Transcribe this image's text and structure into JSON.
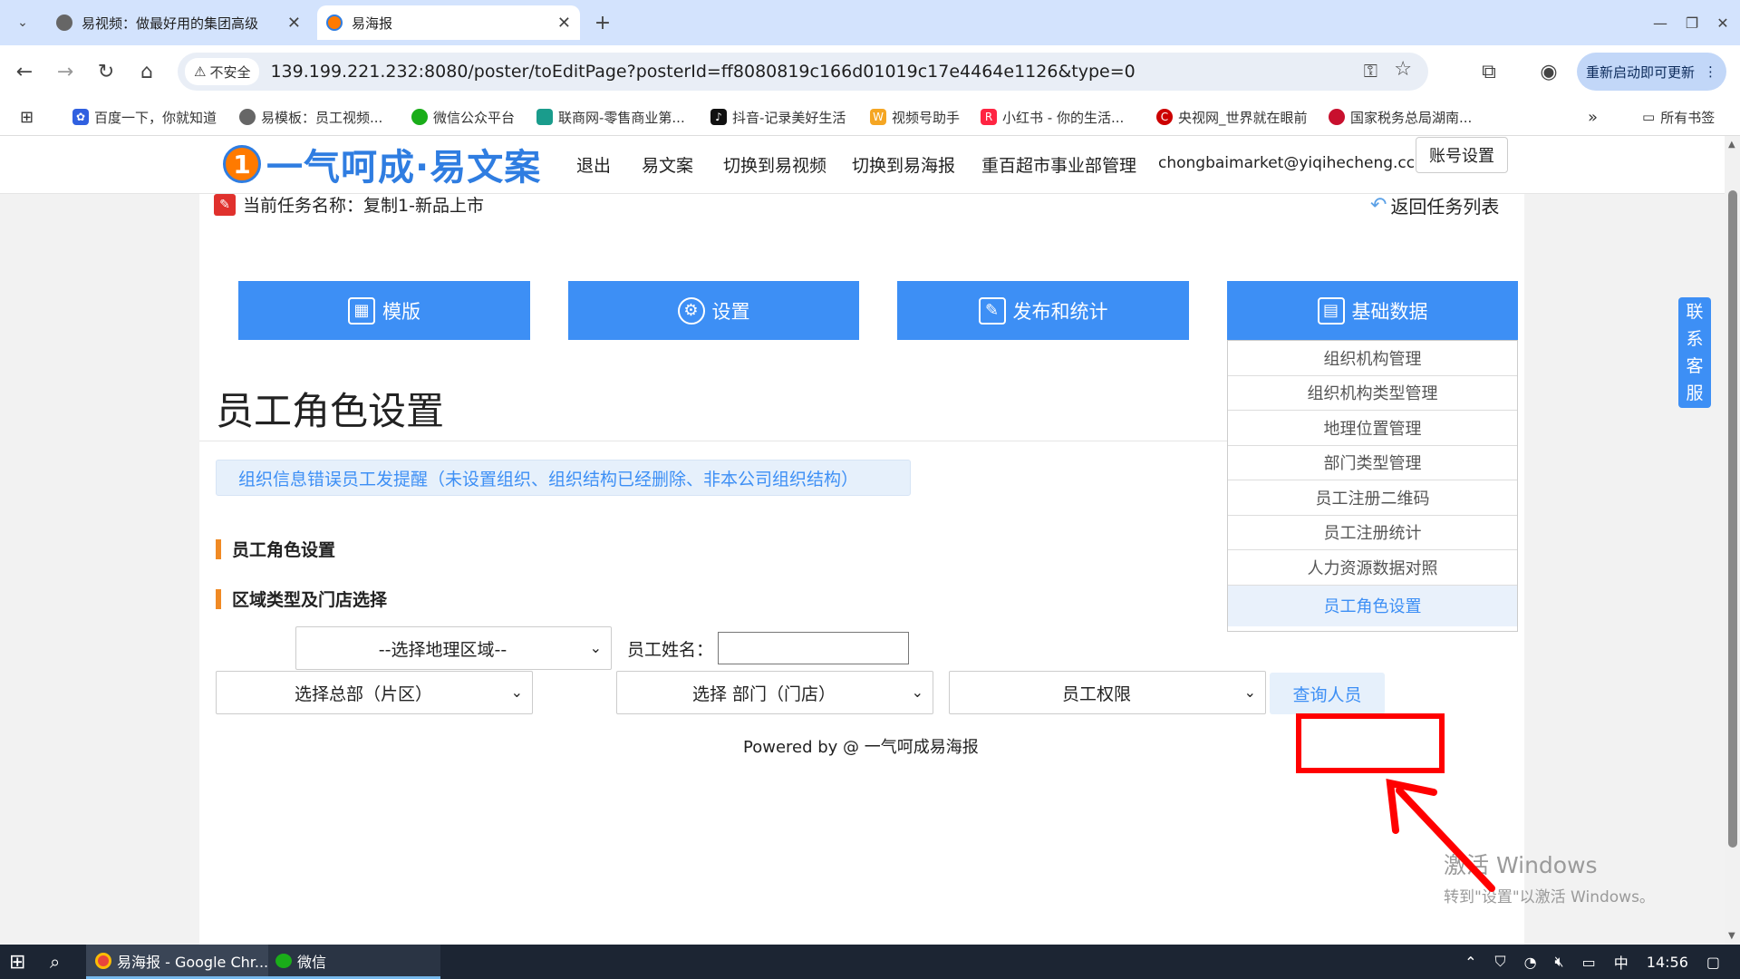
{
  "browser": {
    "tabs": [
      {
        "title": "易视频：做最好用的集团高级"
      },
      {
        "title": "易海报"
      }
    ],
    "new_tab": "+",
    "insecure": "不安全",
    "url": "139.199.221.232:8080/poster/toEditPage?posterId=ff8080819c166d01019c17e4464e1126&type=0",
    "update_button": "重新启动即可更新",
    "bookmarks": [
      "百度一下，你就知道",
      "易模板：员工视频...",
      "微信公众平台",
      "联商网-零售商业第...",
      "抖音-记录美好生活",
      "视频号助手",
      "小红书 - 你的生活...",
      "央视网_世界就在眼前",
      "国家税务总局湖南..."
    ],
    "bookmarks_more": "»",
    "all_bookmarks": "所有书签",
    "window_controls": [
      "—",
      "❐",
      "✕"
    ]
  },
  "site": {
    "logo": "一气呵成·易文案",
    "nav": [
      "退出",
      "易文案",
      "切换到易视频",
      "切换到易海报",
      "重百超市事业部管理",
      "chongbaimarket@yiqihecheng.cc"
    ],
    "account_button": "账号设置",
    "current_task_prefix": "当前任务名称：",
    "current_task_name": "复制1-新品上市",
    "back_to_list": "返回任务列表",
    "big_tabs": [
      {
        "label": "模版",
        "icon": "layout-icon"
      },
      {
        "label": "设置",
        "icon": "gear-icon"
      },
      {
        "label": "发布和统计",
        "icon": "edit-icon"
      },
      {
        "label": "基础数据",
        "icon": "data-icon"
      }
    ],
    "dropdown": [
      "组织机构管理",
      "组织机构类型管理",
      "地理位置管理",
      "部门类型管理",
      "员工注册二维码",
      "员工注册统计",
      "人力资源数据对照",
      "员工角色设置"
    ],
    "page_title": "员工角色设置",
    "alert": "组织信息错误员工发提醒（未设置组织、组织结构已经删除、非本公司组织结构）",
    "section1": "员工角色设置",
    "section2": "区域类型及门店选择",
    "select_geo": "--选择地理区域--",
    "name_label": "员工姓名：",
    "name_value": "",
    "select_hq": "选择总部（片区）",
    "select_dept": "选择 部门（门店）",
    "select_perm": "员工权限",
    "query_button": "查询人员",
    "footer": "Powered by @ 一气呵成易海报",
    "customer_service": [
      "联",
      "系",
      "客",
      "服"
    ],
    "watermark_title": "激活 Windows",
    "watermark_sub": "转到\"设置\"以激活 Windows。"
  },
  "taskbar": {
    "items": [
      "易海报 - Google Chr...",
      "微信"
    ],
    "ime": "中",
    "time": "14:56"
  },
  "colors": {
    "accent": "#3d8ff5",
    "tabstrip": "#d3e3fd",
    "highlight_red": "#ff0000",
    "section_bar": "#f08a24"
  }
}
